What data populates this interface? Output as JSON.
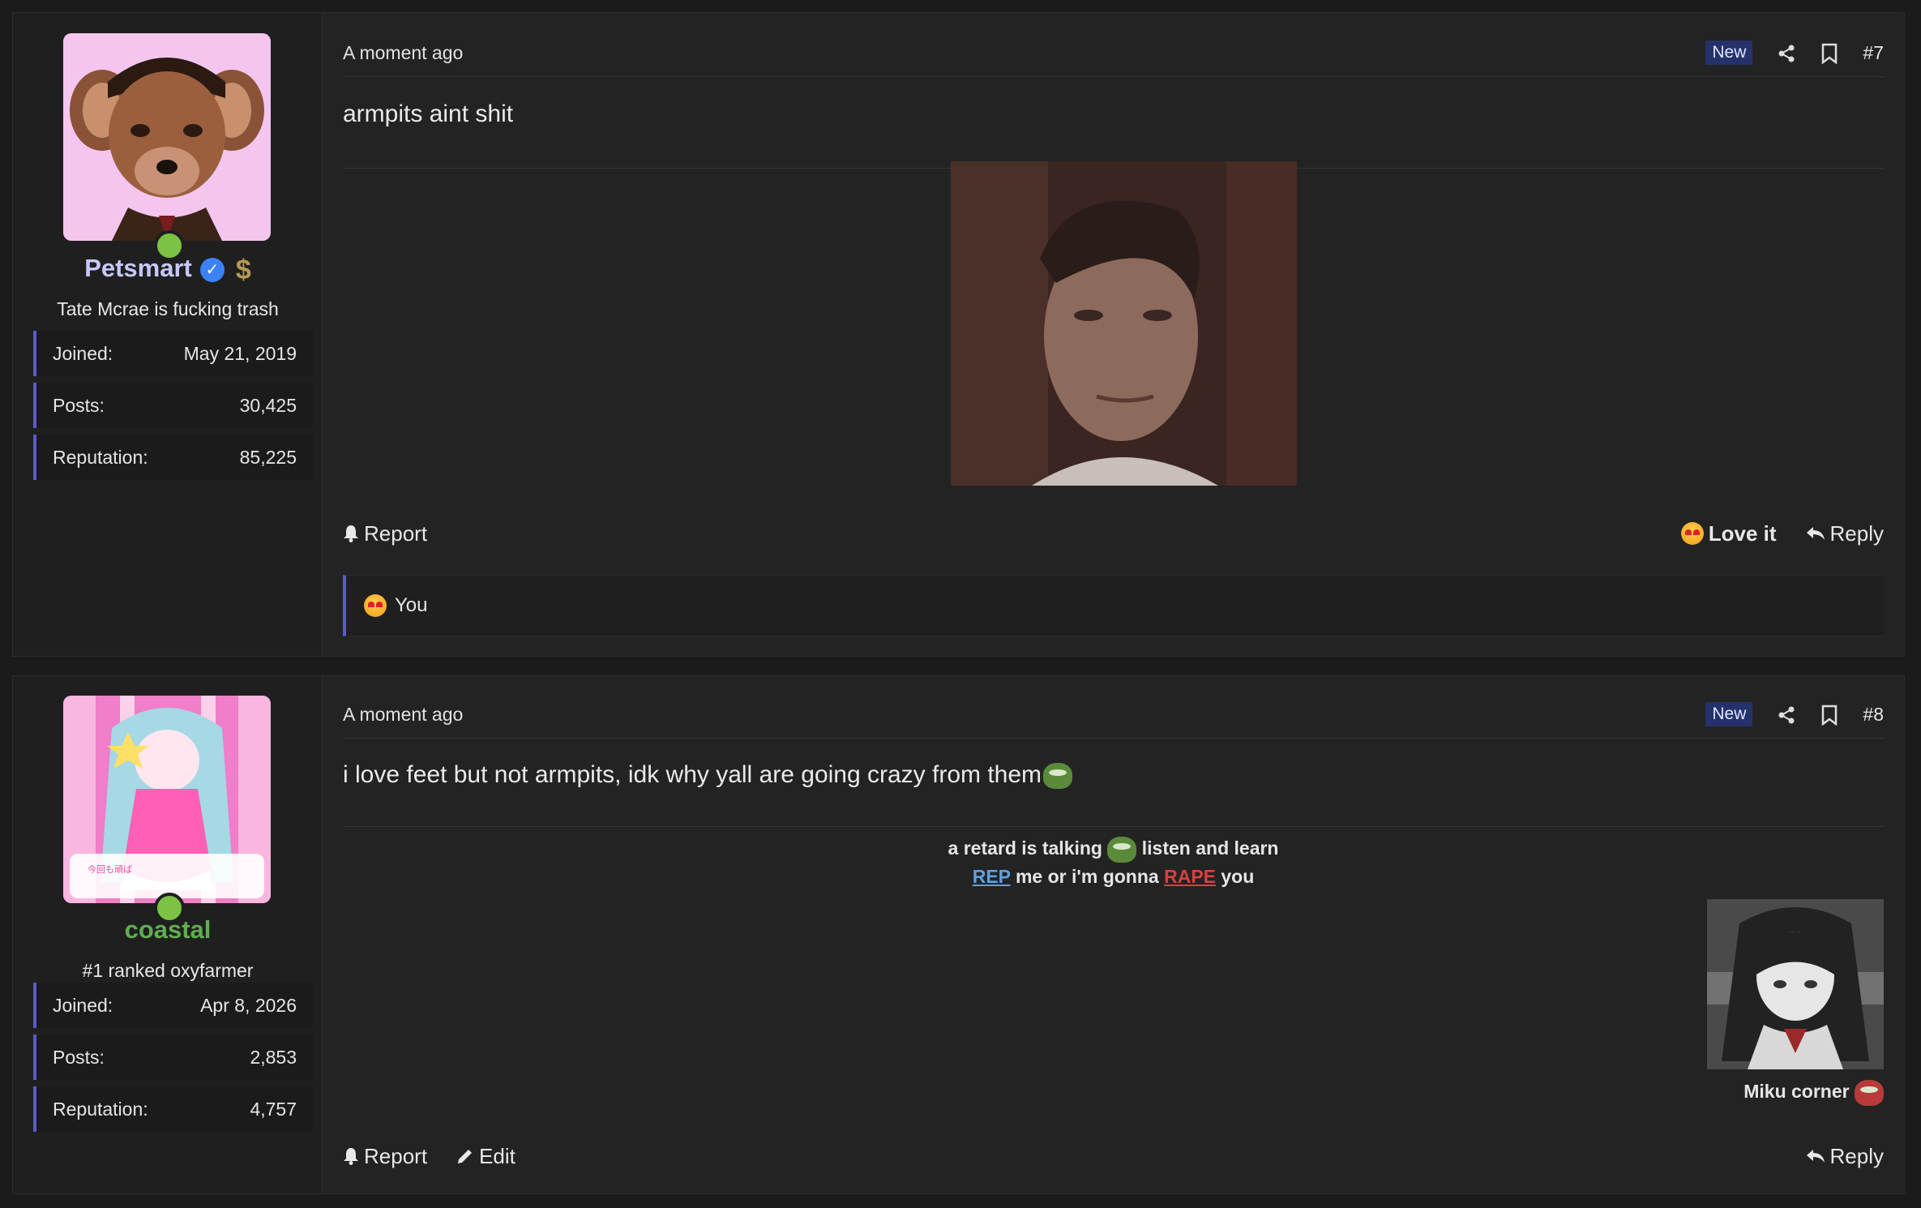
{
  "posts": [
    {
      "user": {
        "name": "Petsmart",
        "title": "Tate Mcrae is fucking trash",
        "stats": [
          {
            "label": "Joined:",
            "value": "May 21, 2019"
          },
          {
            "label": "Posts:",
            "value": "30,425"
          },
          {
            "label": "Reputation:",
            "value": "85,225"
          }
        ]
      },
      "time": "A moment ago",
      "badge": "New",
      "number": "#7",
      "text": "armpits aint shit",
      "actions": {
        "report": "Report",
        "love": "Love it",
        "reply": "Reply"
      },
      "reactions": "You"
    },
    {
      "user": {
        "name": "coastal",
        "title": "#1 ranked oxyfarmer",
        "stats": [
          {
            "label": "Joined:",
            "value": "Apr 8, 2026"
          },
          {
            "label": "Posts:",
            "value": "2,853"
          },
          {
            "label": "Reputation:",
            "value": "4,757"
          }
        ]
      },
      "time": "A moment ago",
      "badge": "New",
      "number": "#8",
      "text": "i love feet but not armpits, idk why yall are going crazy from them",
      "signature": {
        "line1a": "a retard is talking",
        "line1b": "listen and learn",
        "rep": "REP",
        "mid": "me or i'm gonna",
        "rape": "RAPE",
        "end": "you",
        "caption": "Miku corner"
      },
      "actions": {
        "report": "Report",
        "edit": "Edit",
        "reply": "Reply"
      }
    }
  ],
  "colors": {
    "accent": "#5a5ad0",
    "online": "#7cc244",
    "badge_bg": "#25316a",
    "rep": "#5ea0e0",
    "rape": "#d94040"
  }
}
